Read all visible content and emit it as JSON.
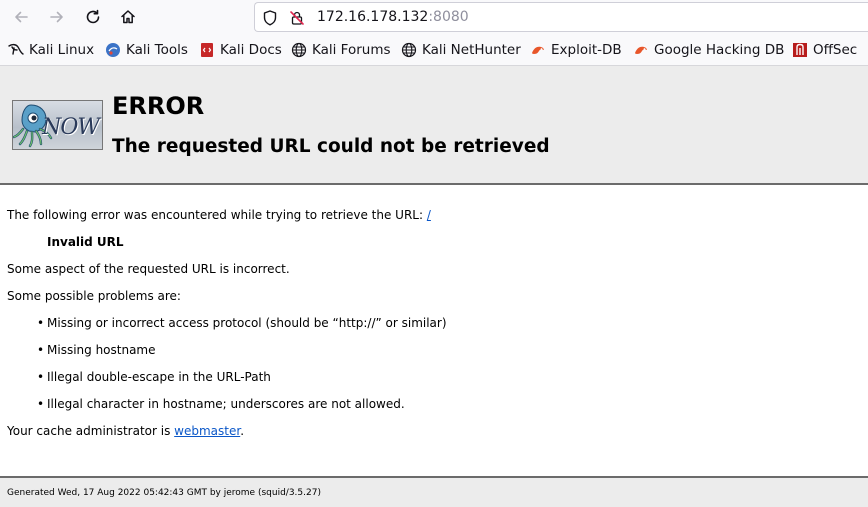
{
  "browser": {
    "url_host": "172.16.178.132",
    "url_port": ":8080",
    "bookmarks": [
      {
        "label": "Kali Linux",
        "icon": "kali-dragon-icon"
      },
      {
        "label": "Kali Tools",
        "icon": "kali-tools-icon"
      },
      {
        "label": "Kali Docs",
        "icon": "kali-docs-icon"
      },
      {
        "label": "Kali Forums",
        "icon": "globe-icon"
      },
      {
        "label": "Kali NetHunter",
        "icon": "globe-icon"
      },
      {
        "label": "Exploit-DB",
        "icon": "exploit-db-icon"
      },
      {
        "label": "Google Hacking DB",
        "icon": "exploit-db-icon"
      },
      {
        "label": "OffSec",
        "icon": "offsec-icon"
      }
    ]
  },
  "error": {
    "logo_text": "NOW",
    "title": "ERROR",
    "subtitle": "The requested URL could not be retrieved",
    "intro": "The following error was encountered while trying to retrieve the URL:",
    "url_link": "/",
    "error_name": "Invalid URL",
    "description": "Some aspect of the requested URL is incorrect.",
    "problems_heading": "Some possible problems are:",
    "problems": [
      "Missing or incorrect access protocol (should be “http://” or similar)",
      "Missing hostname",
      "Illegal double-escape in the URL-Path",
      "Illegal character in hostname; underscores are not allowed."
    ],
    "admin_prefix": "Your cache administrator is",
    "admin_link": "webmaster",
    "admin_suffix": "."
  },
  "footer": {
    "generated": "Generated Wed, 17 Aug 2022 05:42:43 GMT by jerome (squid/3.5.27)"
  }
}
